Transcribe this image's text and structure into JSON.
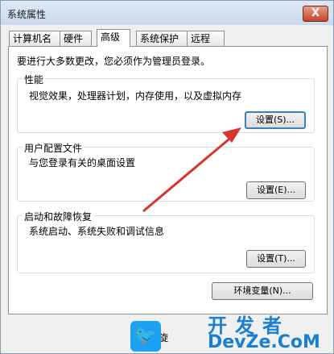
{
  "window": {
    "title": "系统属性",
    "close_label": "X"
  },
  "tabs": [
    "计算机名",
    "硬件",
    "高级",
    "系统保护",
    "远程"
  ],
  "note": "要进行大多数更改，您必须作为管理员登录。",
  "performance": {
    "title": "性能",
    "desc": "视觉效果，处理器计划，内存使用，以及虚拟内存",
    "button": "设置(S)..."
  },
  "profiles": {
    "title": "用户配置文件",
    "desc": "与您登录有关的桌面设置",
    "button": "设置(E)..."
  },
  "startup": {
    "title": "启动和故障恢复",
    "desc": "系统启动、系统失败和调试信息",
    "button": "设置(T)..."
  },
  "env_button": "环境变量(N)...",
  "footer_partial": "旋",
  "watermark": {
    "top": "开发者",
    "bottom": "DevZe.CoM"
  },
  "colors": {
    "arrow": "#d9342b",
    "accent": "#3c7fb1"
  }
}
